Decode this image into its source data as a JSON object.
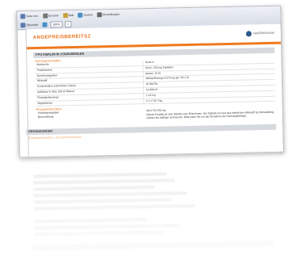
{
  "toolbar": {
    "row1": [
      {
        "icon": "page-icon",
        "label": "Seite einr.",
        "color": "#5a7ab0"
      },
      {
        "icon": "print-icon",
        "label": "Drucken",
        "color": "#777777"
      },
      {
        "icon": "mail-icon",
        "label": "Mail",
        "color": "#c8a040"
      },
      {
        "icon": "find-icon",
        "label": "Suchen",
        "color": "#4a90c8"
      },
      {
        "icon": "settings-icon",
        "label": "Einstellungen",
        "color": "#6a6a6a"
      }
    ],
    "row2": [
      {
        "icon": "layout-icon",
        "label": "Übersicht",
        "color": "#5a7ab0"
      },
      {
        "icon": "zoom-icon",
        "label": "",
        "color": "#4a90c8"
      }
    ],
    "zoom_value": "100%",
    "page_value": "1"
  },
  "document": {
    "title": "ANGEPREISBEREITSZ",
    "logo_text": "A|ARENDRAUW",
    "section1": "FPO KWALIM IN CONSUMENLEN",
    "subhead1": "Kerneigenschaften",
    "rows": [
      {
        "k": "Marktsorte",
        "v": "Sorte A"
      },
      {
        "k": "Produktname",
        "v": "Sirmi - 550 mg Tabletten"
      },
      {
        "k": "Darreichungsform",
        "v": "Beutel, 10 St"
      },
      {
        "k": "Wirkstoff",
        "v": "Wirkstoffmenge A 570 mg pro Tbl 1 St"
      },
      {
        "k": "Konzentration zubereitete Lösung",
        "v": "10 Stk/Tbl"
      },
      {
        "k": "Auflösbar in Glas 100 ml Wasser",
        "v": "10-200 ml"
      },
      {
        "k": "Flüssigkeitsmenge",
        "v": "1-10 mg"
      },
      {
        "k": "Abgabedosis",
        "v": "2 x 1 Tbl / Tag"
      }
    ],
    "subhead2": "Produktinformation",
    "desc_rows": [
      {
        "k": "Packungsangaben",
        "v": "Sirmi Tbl 550 mg"
      },
      {
        "k": "Beschreibung",
        "v": "Dieses Produkt ist eine Tablette zum Einnehmen. Die Tablette ist rund und enthält den Wirkstoff zur Behandlung leichter bis mäßiger Schmerzen. Bitte lesen Sie vor der Einnahme die Packungsbeilage."
      }
    ],
    "section2": "ERGÄNZUNGEN",
    "faint_text": "Einheitenübersicht u. Zusatzinformationen"
  }
}
